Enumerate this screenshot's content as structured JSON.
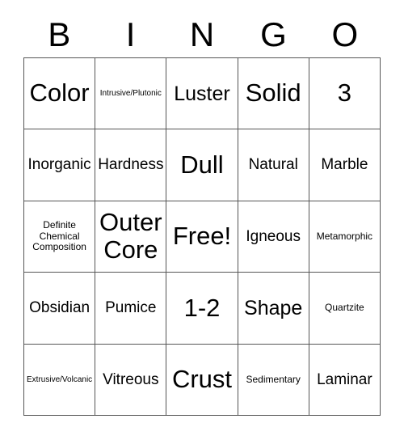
{
  "card": {
    "header_letters": [
      "B",
      "I",
      "N",
      "G",
      "O"
    ],
    "columns": [
      "B",
      "I",
      "N",
      "G",
      "O"
    ],
    "free_space_label": "Free!",
    "border_color": "#555555",
    "text_color": "#000000",
    "background_color": "#ffffff",
    "rows": [
      [
        {
          "label": "Color",
          "size": "xl"
        },
        {
          "label": "Intrusive/Plutonic",
          "size": "xs"
        },
        {
          "label": "Luster",
          "size": "lg"
        },
        {
          "label": "Solid",
          "size": "xl"
        },
        {
          "label": "3",
          "size": "xl"
        }
      ],
      [
        {
          "label": "Inorganic",
          "size": "md"
        },
        {
          "label": "Hardness",
          "size": "md"
        },
        {
          "label": "Dull",
          "size": "xl"
        },
        {
          "label": "Natural",
          "size": "md"
        },
        {
          "label": "Marble",
          "size": "md"
        }
      ],
      [
        {
          "label": "Definite\nChemical\nComposition",
          "size": "sm"
        },
        {
          "label": "Outer\nCore",
          "size": "xl"
        },
        {
          "label": "Free!",
          "size": "xl"
        },
        {
          "label": "Igneous",
          "size": "md"
        },
        {
          "label": "Metamorphic",
          "size": "sm"
        }
      ],
      [
        {
          "label": "Obsidian",
          "size": "md"
        },
        {
          "label": "Pumice",
          "size": "md"
        },
        {
          "label": "1-2",
          "size": "xl"
        },
        {
          "label": "Shape",
          "size": "lg"
        },
        {
          "label": "Quartzite",
          "size": "sm"
        }
      ],
      [
        {
          "label": "Extrusive/Volcanic",
          "size": "xs"
        },
        {
          "label": "Vitreous",
          "size": "md"
        },
        {
          "label": "Crust",
          "size": "xl"
        },
        {
          "label": "Sedimentary",
          "size": "sm"
        },
        {
          "label": "Laminar",
          "size": "md"
        }
      ]
    ]
  }
}
